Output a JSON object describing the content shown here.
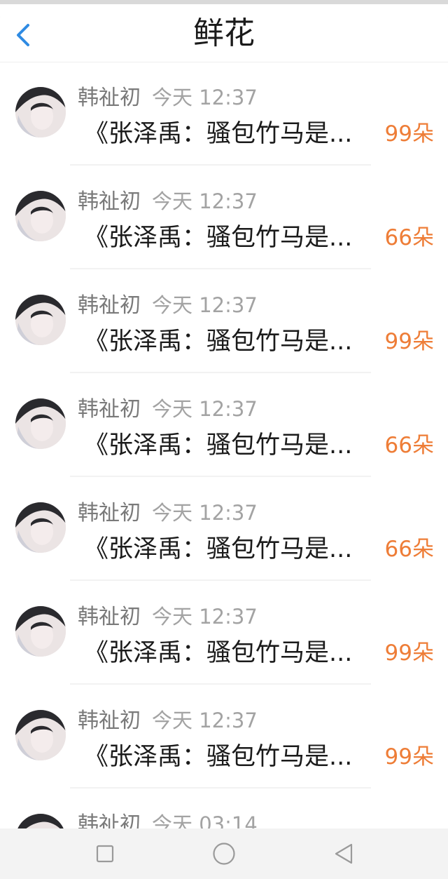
{
  "header": {
    "title": "鲜花",
    "back_icon": "chevron-left-icon"
  },
  "colors": {
    "accent": "#2f8be3",
    "count": "#ee7d37"
  },
  "items": [
    {
      "name": "韩祉初",
      "time": "今天 12:37",
      "message": "《张泽禹：骚包竹马是...",
      "count": "99朵"
    },
    {
      "name": "韩祉初",
      "time": "今天 12:37",
      "message": "《张泽禹：骚包竹马是...",
      "count": "66朵"
    },
    {
      "name": "韩祉初",
      "time": "今天 12:37",
      "message": "《张泽禹：骚包竹马是...",
      "count": "99朵"
    },
    {
      "name": "韩祉初",
      "time": "今天 12:37",
      "message": "《张泽禹：骚包竹马是...",
      "count": "66朵"
    },
    {
      "name": "韩祉初",
      "time": "今天 12:37",
      "message": "《张泽禹：骚包竹马是...",
      "count": "66朵"
    },
    {
      "name": "韩祉初",
      "time": "今天 12:37",
      "message": "《张泽禹：骚包竹马是...",
      "count": "99朵"
    },
    {
      "name": "韩祉初",
      "time": "今天 12:37",
      "message": "《张泽禹：骚包竹马是...",
      "count": "99朵"
    },
    {
      "name": "韩祉初",
      "time": "今天 03:14",
      "message": "",
      "count": ""
    }
  ],
  "navbar": {
    "icons": [
      "square-icon",
      "circle-icon",
      "triangle-back-icon"
    ]
  }
}
